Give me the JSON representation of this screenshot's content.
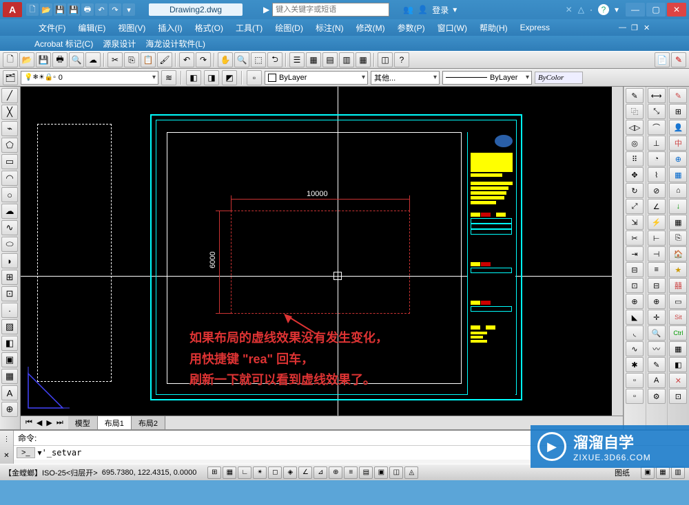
{
  "title": {
    "doc": "Drawing2.dwg",
    "logo": "A"
  },
  "search": {
    "placeholder": "键入关键字或短语"
  },
  "login": {
    "label": "登录"
  },
  "menu": {
    "items": [
      "文件(F)",
      "编辑(E)",
      "视图(V)",
      "插入(I)",
      "格式(O)",
      "工具(T)",
      "绘图(D)",
      "标注(N)",
      "修改(M)",
      "参数(P)",
      "窗口(W)",
      "帮助(H)",
      "Express"
    ],
    "items2": [
      "Acrobat 标记(C)",
      "源泉设计",
      "海龙设计软件(L)"
    ]
  },
  "layers": {
    "current": "0"
  },
  "props": {
    "color": "ByLayer",
    "other": "其他...",
    "lineweight": "ByLayer",
    "plotstyle": "ByColor"
  },
  "dims": {
    "width": "10000",
    "height": "6000"
  },
  "annotation": {
    "l1": "如果布局的虚线效果没有发生变化，",
    "l2": "用快捷键 \"rea\" 回车，",
    "l3": "刷新一下就可以看到虚线效果了。"
  },
  "tabs": {
    "model": "模型",
    "layout1": "布局1",
    "layout2": "布局2"
  },
  "cmd": {
    "label": "命令:",
    "prompt": ">_",
    "input": "'_setvar"
  },
  "status": {
    "style": "【金螳螂】ISO-25<归层开>",
    "coords": "695.7380, 122.4315, 0.0000",
    "paper": "图纸"
  },
  "watermark": {
    "brand": "溜溜自学",
    "url": "ZIXUE.3D66.COM"
  }
}
